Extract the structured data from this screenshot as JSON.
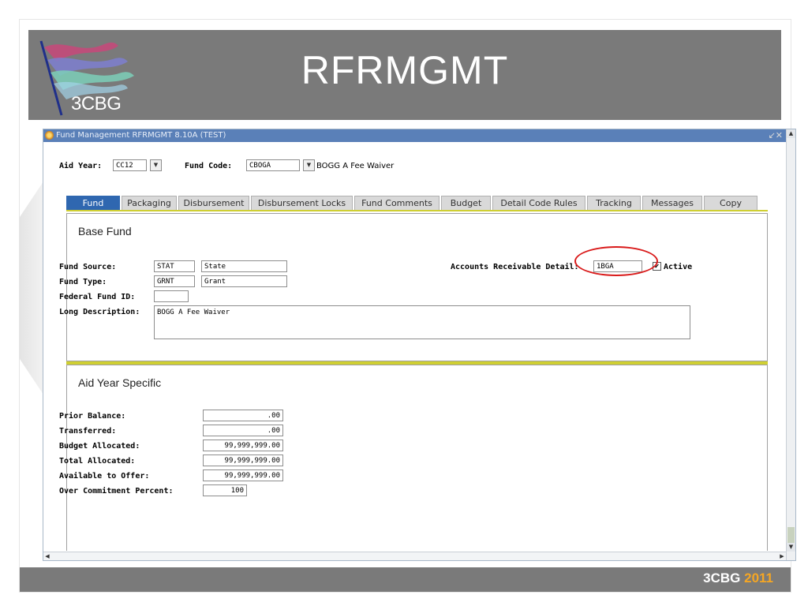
{
  "slide": {
    "title": "RFRMGMT",
    "logo_text": "3CBG",
    "footer_brand": "3CBG",
    "footer_year": "2011",
    "accent_color": "#f5a623",
    "header_color": "#7a7a7a"
  },
  "window": {
    "title": "Fund Management  RFRMGMT  8.10A  (TEST)",
    "controls": "↙✕"
  },
  "key_block": {
    "aid_year_label": "Aid Year:",
    "aid_year_value": "CC12",
    "fund_code_label": "Fund Code:",
    "fund_code_value": "CBOGA",
    "fund_code_desc": "BOGG A Fee Waiver"
  },
  "tabs": [
    {
      "label": "Fund",
      "active": true
    },
    {
      "label": "Packaging",
      "active": false
    },
    {
      "label": "Disbursement",
      "active": false
    },
    {
      "label": "Disbursement Locks",
      "active": false
    },
    {
      "label": "Fund Comments",
      "active": false
    },
    {
      "label": "Budget",
      "active": false
    },
    {
      "label": "Detail Code Rules",
      "active": false
    },
    {
      "label": "Tracking",
      "active": false
    },
    {
      "label": "Messages",
      "active": false
    },
    {
      "label": "Copy",
      "active": false
    }
  ],
  "base_fund": {
    "title": "Base Fund",
    "fund_source_label": "Fund Source:",
    "fund_source_code": "STAT",
    "fund_source_desc": "State",
    "fund_type_label": "Fund Type:",
    "fund_type_code": "GRNT",
    "fund_type_desc": "Grant",
    "federal_fund_id_label": "Federal Fund ID:",
    "federal_fund_id_value": "",
    "long_desc_label": "Long Description:",
    "long_desc_value": "BOGG A Fee Waiver",
    "ar_detail_label": "Accounts Receivable Detail:",
    "ar_detail_value": "1BGA",
    "active_label": "Active",
    "active_checked": true
  },
  "aid_year_specific": {
    "title": "Aid Year Specific",
    "rows": [
      {
        "label": "Prior Balance:",
        "value": ".00"
      },
      {
        "label": "Transferred:",
        "value": ".00"
      },
      {
        "label": "Budget Allocated:",
        "value": "99,999,999.00"
      },
      {
        "label": "Total Allocated:",
        "value": "99,999,999.00"
      },
      {
        "label": "Available to Offer:",
        "value": "99,999,999.00"
      },
      {
        "label": "Over Commitment Percent:",
        "value": "100"
      }
    ]
  },
  "highlight_color": "#d91a1a"
}
